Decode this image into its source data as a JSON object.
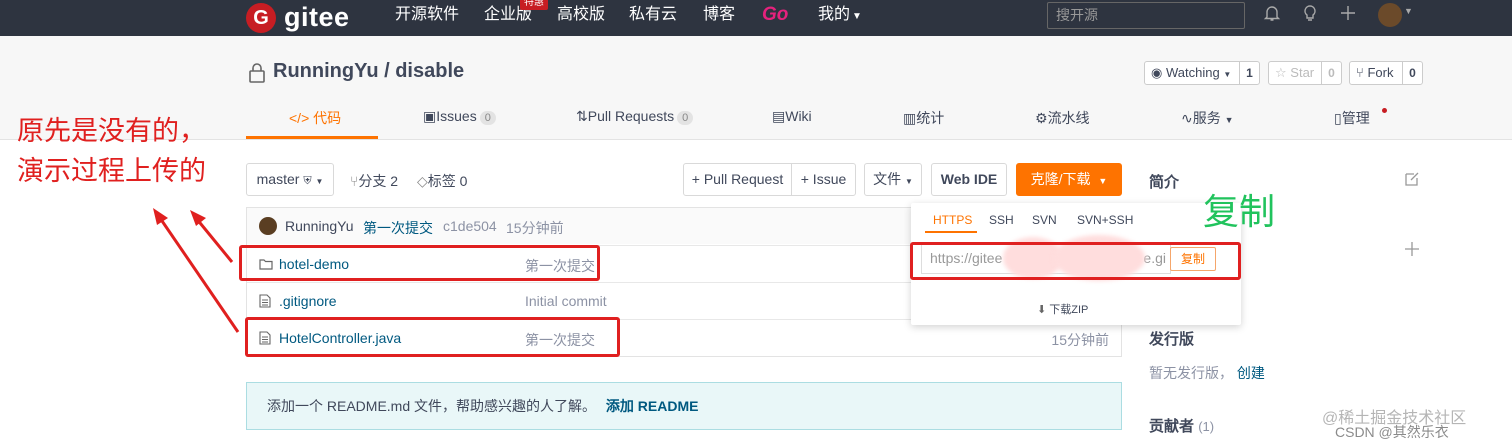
{
  "topbar": {
    "logo_glyph": "G",
    "logo_text": "gitee",
    "nav": [
      "开源软件",
      "企业版",
      "高校版",
      "私有云",
      "博客"
    ],
    "hot_badge": "特惠",
    "go_label": "Go",
    "mine_label": "我的",
    "search_placeholder": "搜开源"
  },
  "repo": {
    "path": "RunningYu / disable",
    "watch_label": "Watching",
    "watch_count": "1",
    "star_label": "Star",
    "star_count": "0",
    "fork_label": "Fork",
    "fork_count": "0"
  },
  "tabs": {
    "code": "代码",
    "issues": "Issues",
    "issues_count": "0",
    "prs": "Pull Requests",
    "prs_count": "0",
    "wiki": "Wiki",
    "stats": "统计",
    "pipeline": "流水线",
    "services": "服务",
    "manage": "管理"
  },
  "toolbar": {
    "branch": "master",
    "branches": "分支 2",
    "tags": "标签 0",
    "new_pr": "+ Pull Request",
    "new_issue": "+ Issue",
    "file": "文件",
    "web_ide": "Web IDE",
    "clone": "克隆/下载"
  },
  "commit": {
    "author": "RunningYu",
    "message": "第一次提交",
    "hash": "c1de504",
    "time": "15分钟前"
  },
  "files": [
    {
      "name": "hotel-demo",
      "message": "第一次提交",
      "time": ""
    },
    {
      "name": ".gitignore",
      "message": "Initial commit",
      "time": ""
    },
    {
      "name": "HotelController.java",
      "message": "第一次提交",
      "time": "15分钟前"
    }
  ],
  "clone_panel": {
    "protocols": [
      "HTTPS",
      "SSH",
      "SVN",
      "SVN+SSH"
    ],
    "url_start": "https://gitee",
    "url_end": "e.gi",
    "copy": "复制",
    "download_zip": "下载ZIP"
  },
  "readme": {
    "text": "添加一个 README.md 文件，帮助感兴趣的人了解。",
    "link": "添加 README"
  },
  "sidebar": {
    "intro": "简介",
    "releases": "发行版",
    "no_release": "暂无发行版，",
    "create": "创建",
    "contributors": "贡献者",
    "contributors_count": "(1)"
  },
  "annotations": {
    "left_line1": "原先是没有的，",
    "left_line2": "演示过程上传的",
    "copy_note": "复制"
  },
  "watermark": {
    "line1": "@稀土掘金技术社区",
    "line2": "CSDN @其然乐衣"
  },
  "colors": {
    "accent": "#fe7300",
    "topbar": "#2e3440",
    "annotation": "#e0201f",
    "note": "#21c35d"
  }
}
